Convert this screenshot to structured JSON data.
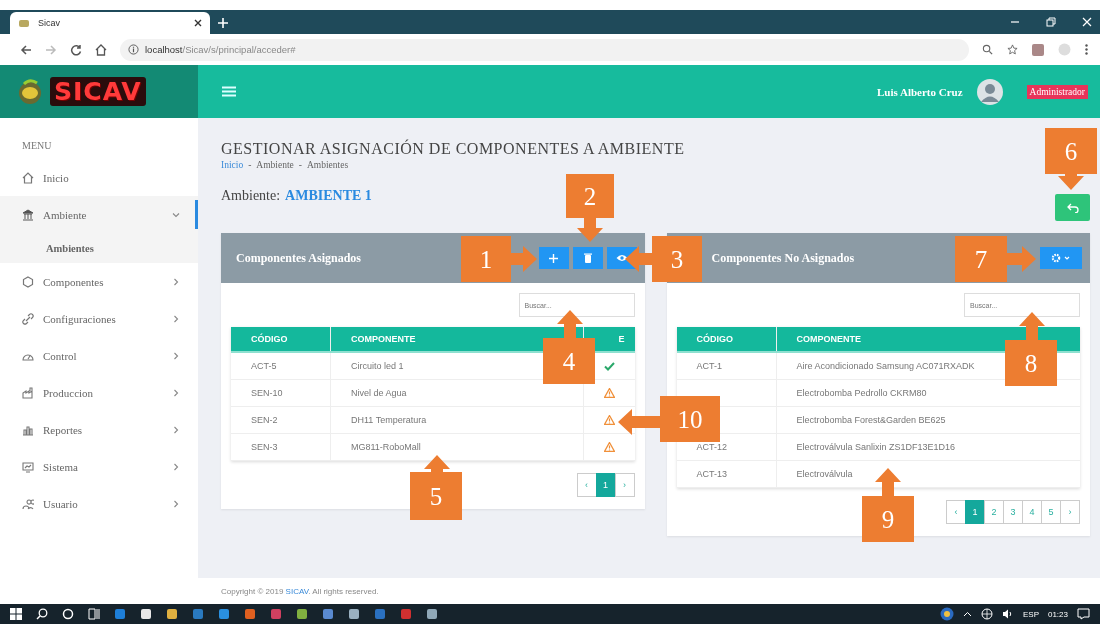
{
  "browser": {
    "tab": {
      "title": "Sicav"
    },
    "url": {
      "host": "localhost",
      "path": "/Sicav/s/principal/acceder#"
    }
  },
  "app": {
    "logo": "SICAV",
    "user": {
      "name": "Luis Alberto Cruz",
      "role": "Administrador"
    }
  },
  "sidebar": {
    "heading": "MENU",
    "items": [
      {
        "label": "Inicio",
        "kind": "link",
        "selected": false
      },
      {
        "label": "Ambiente",
        "kind": "group",
        "expanded": true,
        "selected": true,
        "children": [
          {
            "label": "Ambientes",
            "selected": true
          }
        ]
      },
      {
        "label": "Componentes",
        "kind": "group",
        "expanded": false,
        "selected": false
      },
      {
        "label": "Configuraciones",
        "kind": "group",
        "expanded": false,
        "selected": false
      },
      {
        "label": "Control",
        "kind": "group",
        "expanded": false,
        "selected": false
      },
      {
        "label": "Produccion",
        "kind": "group",
        "expanded": false,
        "selected": false
      },
      {
        "label": "Reportes",
        "kind": "group",
        "expanded": false,
        "selected": false
      },
      {
        "label": "Sistema",
        "kind": "group",
        "expanded": false,
        "selected": false
      },
      {
        "label": "Usuario",
        "kind": "group",
        "expanded": false,
        "selected": false
      }
    ]
  },
  "page": {
    "title": "GESTIONAR ASIGNACIÓN DE COMPONENTES A AMBIENTE",
    "breadcrumb": {
      "separator": "-",
      "items": [
        "Inicio",
        "Ambiente",
        "Ambientes"
      ]
    },
    "ambiente_label": "Ambiente:",
    "ambiente_value": "AMBIENTE 1"
  },
  "panels": [
    {
      "title": "Componentes Asignados",
      "actions": [
        {
          "kind": "add"
        },
        {
          "kind": "delete"
        },
        {
          "kind": "view"
        }
      ],
      "search": {
        "placeholder": "Buscar..."
      },
      "columns": [
        "CÓDIGO",
        "COMPONENTE",
        "E"
      ],
      "rows": [
        {
          "code": "ACT-5",
          "name": "Circuito led 1",
          "kind": "ok"
        },
        {
          "code": "SEN-10",
          "name": "Nivel de Agua",
          "kind": "warning"
        },
        {
          "code": "SEN-2",
          "name": "DH11 Temperatura",
          "kind": "warning"
        },
        {
          "code": "SEN-3",
          "name": "MG811-RoboMall",
          "kind": "warning"
        }
      ],
      "pagination": {
        "prev": "‹",
        "next": "›",
        "pages": [
          {
            "label": "1",
            "selected": true
          }
        ]
      }
    },
    {
      "title": "Componentes No Asignados",
      "actions": [
        {
          "kind": "settings"
        }
      ],
      "search": {
        "placeholder": "Buscar..."
      },
      "columns": [
        "CÓDIGO",
        "COMPONENTE"
      ],
      "rows": [
        {
          "code": "ACT-1",
          "name": "Aire Acondicionado Samsung AC071RXADK"
        },
        {
          "name": "Electrobomba Pedrollo CKRM80"
        },
        {
          "name": "Electrobomba Forest&Garden BE625"
        },
        {
          "code": "ACT-12",
          "name": "Electroválvula Sanlixin ZS1DF13E1D16"
        },
        {
          "code": "ACT-13",
          "name": "Electroválvula"
        }
      ],
      "pagination": {
        "prev": "‹",
        "next": "›",
        "pages": [
          {
            "label": "1",
            "selected": true
          },
          {
            "label": "2",
            "selected": false
          },
          {
            "label": "3",
            "selected": false
          },
          {
            "label": "4",
            "selected": false
          },
          {
            "label": "5",
            "selected": false
          }
        ]
      }
    }
  ],
  "footer": {
    "before": "Copyright © 2019",
    "link": "SICAV",
    "after": ". All rights reserved."
  },
  "taskbar": {
    "language": "ESP",
    "time": "01:23"
  },
  "callouts": [
    {
      "label": "1"
    },
    {
      "label": "2"
    },
    {
      "label": "3"
    },
    {
      "label": "4"
    },
    {
      "label": "5"
    },
    {
      "label": "6"
    },
    {
      "label": "7"
    },
    {
      "label": "8"
    },
    {
      "label": "9"
    },
    {
      "label": "10"
    }
  ]
}
